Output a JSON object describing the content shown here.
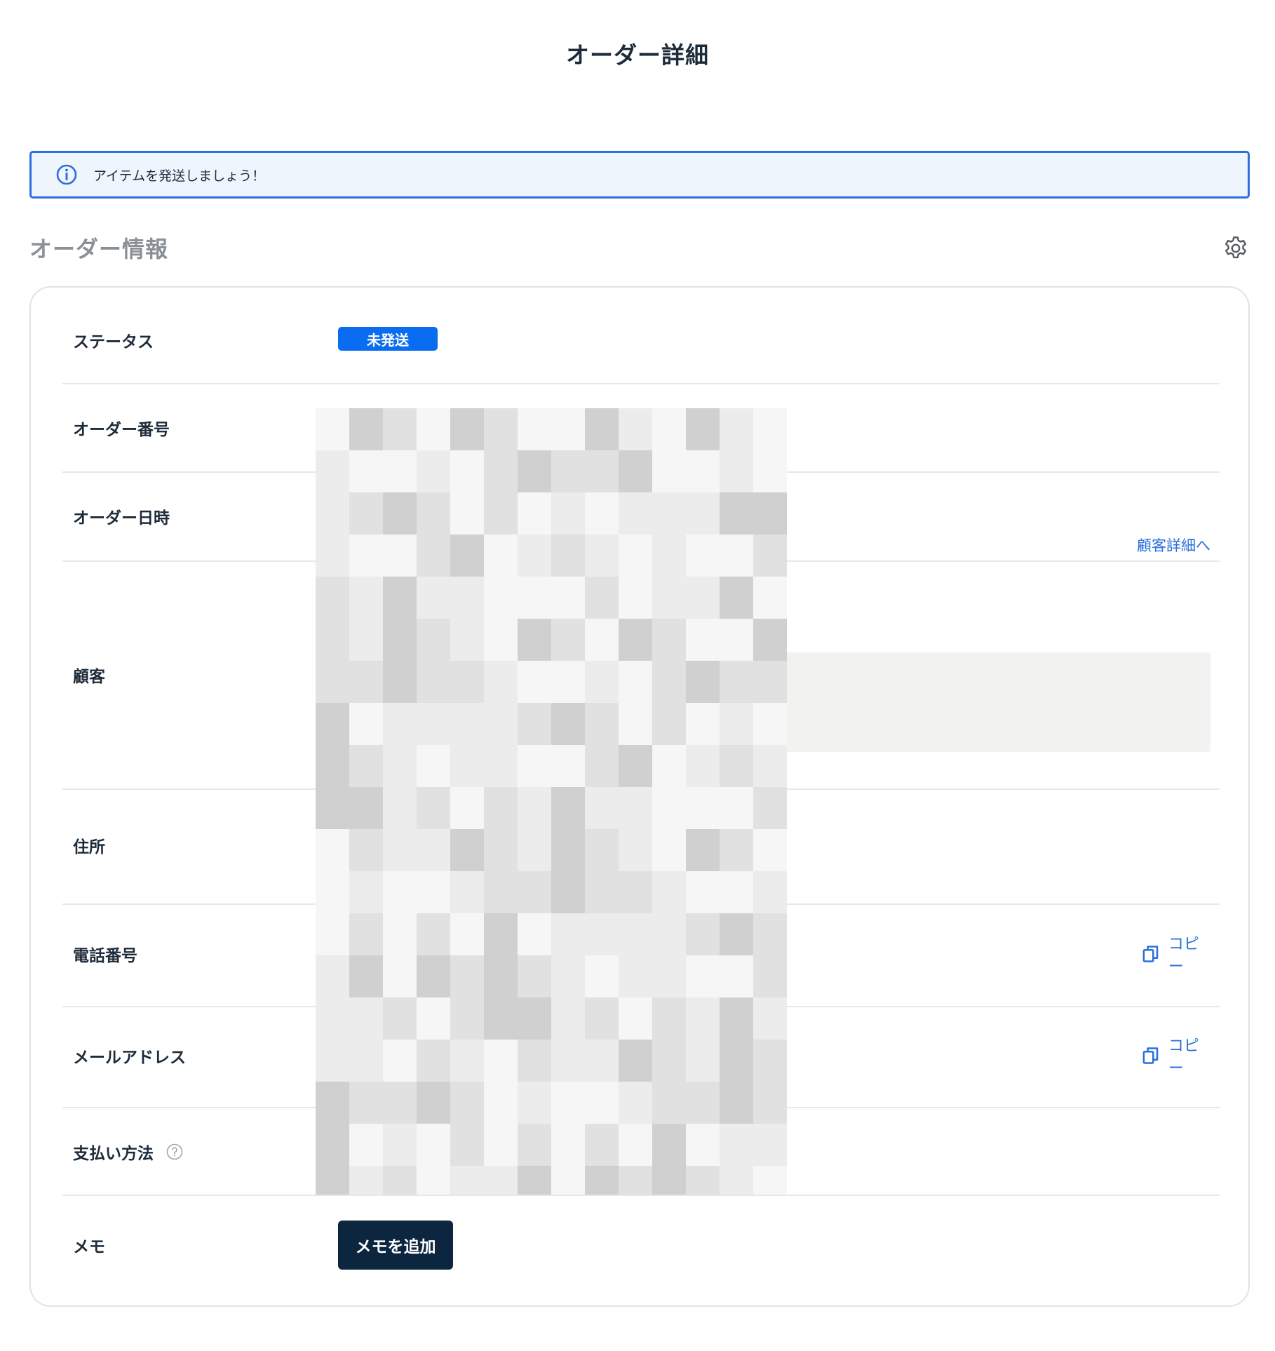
{
  "header": {
    "title": "オーダー詳細"
  },
  "banner": {
    "icon": "info-circle-icon",
    "message": "アイテムを発送しましょう！",
    "border_color": "#2e6fdc",
    "background_color": "#eef5fd"
  },
  "section": {
    "title": "オーダー情報",
    "settings_icon": "gear-icon"
  },
  "rows": {
    "status": {
      "label": "ステータス",
      "badge": "未発送",
      "badge_color": "#0a6cf0"
    },
    "order_number": {
      "label": "オーダー番号"
    },
    "order_datetime": {
      "label": "オーダー日時"
    },
    "customer": {
      "label": "顧客",
      "detail_link": "顧客詳細へ"
    },
    "address": {
      "label": "住所"
    },
    "phone": {
      "label": "電話番号",
      "copy_label": "コピー",
      "copy_icon": "copy-icon"
    },
    "email": {
      "label": "メールアドレス",
      "copy_label": "コピー",
      "copy_icon": "copy-icon"
    },
    "payment_method": {
      "label": "支払い方法",
      "help_icon": "question-circle-icon"
    },
    "memo": {
      "label": "メモ",
      "button_label": "メモを追加",
      "button_color": "#0c2640"
    }
  },
  "colors": {
    "accent": "#2a6fdb",
    "text": "#1d2b3a",
    "muted": "#8a9096"
  }
}
